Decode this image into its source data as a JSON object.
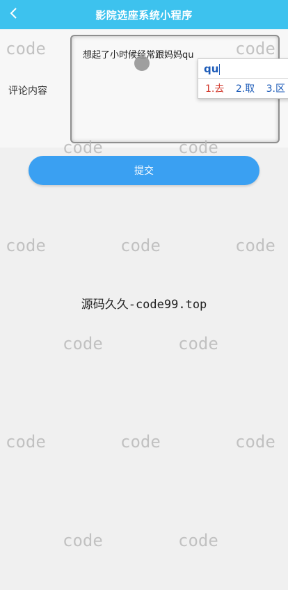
{
  "header": {
    "title": "影院选座系统小程序",
    "back_icon": "chevron-left-icon"
  },
  "form": {
    "comment_label": "评论内容",
    "comment_value": "想起了小时候经常跟妈妈qu"
  },
  "ime": {
    "input": "qu",
    "candidates": [
      "1.去",
      "2.取",
      "3.区"
    ]
  },
  "submit": {
    "label": "提交"
  },
  "watermark": {
    "text": "code",
    "site_text": "源码久久-code99.top"
  },
  "colors": {
    "navbar": "#3dc2ee",
    "button": "#3aa0f2",
    "background": "#f0f0f0"
  }
}
